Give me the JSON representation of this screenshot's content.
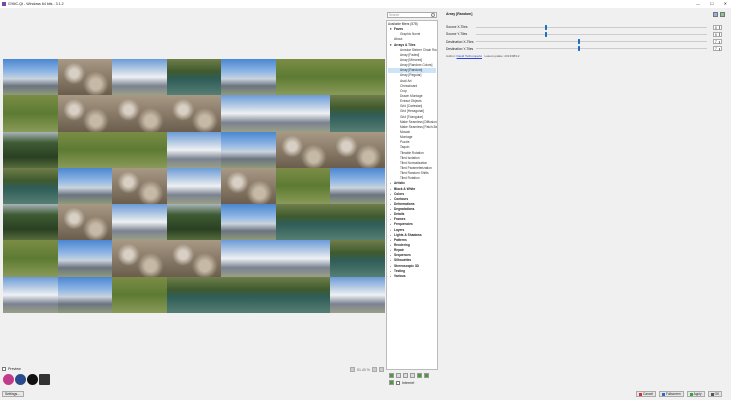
{
  "window": {
    "title": "G'MIC-Qt - Windows 64 bits - 3.1.2",
    "controls": [
      "—",
      "☐",
      "✕"
    ]
  },
  "preview": {
    "checkbox_label": "Preview",
    "checked": true,
    "zoom": "51.43 %"
  },
  "filters": {
    "search_placeholder": "Search",
    "header": "Available filters (578)",
    "items": [
      {
        "kind": "cat",
        "state": "exp",
        "label": "Faves"
      },
      {
        "kind": "it",
        "label": "Graphic Novel"
      },
      {
        "kind": "top",
        "label": "About"
      },
      {
        "kind": "cat",
        "state": "exp",
        "label": "Arrays & Tiles"
      },
      {
        "kind": "it",
        "label": "Annular Steiner Chain Round"
      },
      {
        "kind": "it",
        "label": "Array [Faded]"
      },
      {
        "kind": "it",
        "label": "Array [Mirrored]"
      },
      {
        "kind": "it",
        "label": "Array [Random Colors]"
      },
      {
        "kind": "it",
        "label": "Array [Random]",
        "selected": true
      },
      {
        "kind": "it",
        "label": "Array [Regular]"
      },
      {
        "kind": "it",
        "label": "Ascii Art"
      },
      {
        "kind": "it",
        "label": "Chessboard"
      },
      {
        "kind": "it",
        "label": "Crop"
      },
      {
        "kind": "it",
        "label": "Drawn Montage"
      },
      {
        "kind": "it",
        "label": "Extract Objects"
      },
      {
        "kind": "it",
        "label": "Grid [Cartesian]"
      },
      {
        "kind": "it",
        "label": "Grid [Hexagonal]"
      },
      {
        "kind": "it",
        "label": "Grid [Triangular]"
      },
      {
        "kind": "it",
        "label": "Make Seamless [Diffusion]"
      },
      {
        "kind": "it",
        "label": "Make Seamless [Patch-Based]"
      },
      {
        "kind": "it",
        "label": "Mosaic"
      },
      {
        "kind": "it",
        "label": "Montage"
      },
      {
        "kind": "it",
        "label": "Puzzle"
      },
      {
        "kind": "it",
        "label": "Taquin"
      },
      {
        "kind": "it",
        "label": "Tileable Rotation"
      },
      {
        "kind": "it",
        "label": "Tiled Isolation"
      },
      {
        "kind": "it",
        "label": "Tiled Normalization"
      },
      {
        "kind": "it",
        "label": "Tiled Parameterization"
      },
      {
        "kind": "it",
        "label": "Tiled Random Shifts"
      },
      {
        "kind": "it",
        "label": "Tiled Rotation"
      },
      {
        "kind": "cat",
        "state": "col",
        "label": "Artistic"
      },
      {
        "kind": "cat",
        "state": "col",
        "label": "Black & White"
      },
      {
        "kind": "cat",
        "state": "col",
        "label": "Colors"
      },
      {
        "kind": "cat",
        "state": "col",
        "label": "Contours"
      },
      {
        "kind": "cat",
        "state": "col",
        "label": "Deformations"
      },
      {
        "kind": "cat",
        "state": "col",
        "label": "Degradations"
      },
      {
        "kind": "cat",
        "state": "col",
        "label": "Details"
      },
      {
        "kind": "cat",
        "state": "col",
        "label": "Frames"
      },
      {
        "kind": "cat",
        "state": "col",
        "label": "Frequencies"
      },
      {
        "kind": "cat",
        "state": "col",
        "label": "Layers"
      },
      {
        "kind": "cat",
        "state": "col",
        "label": "Lights & Shadows"
      },
      {
        "kind": "cat",
        "state": "col",
        "label": "Patterns"
      },
      {
        "kind": "cat",
        "state": "col",
        "label": "Rendering"
      },
      {
        "kind": "cat",
        "state": "col",
        "label": "Repair"
      },
      {
        "kind": "cat",
        "state": "col",
        "label": "Sequences"
      },
      {
        "kind": "cat",
        "state": "col",
        "label": "Silhouettes"
      },
      {
        "kind": "cat",
        "state": "col",
        "label": "Stereoscopic 3D"
      },
      {
        "kind": "cat",
        "state": "col",
        "label": "Testing"
      },
      {
        "kind": "cat",
        "state": "col",
        "label": "Various"
      }
    ],
    "internet_label": "Internet",
    "internet_checked": true
  },
  "params": {
    "title": "Array [Random]",
    "rows": [
      {
        "label": "Source X-Tiles",
        "value": 5,
        "fraction": 0.3
      },
      {
        "label": "Source Y-Tiles",
        "value": 5,
        "fraction": 0.3
      },
      {
        "label": "Destination X-Tiles",
        "value": 7,
        "fraction": 0.44
      },
      {
        "label": "Destination Y-Tiles",
        "value": 7,
        "fraction": 0.44
      }
    ],
    "author_label": "Author:",
    "author": "David Tschumperlé",
    "update": "Latest update: 2013/08/12"
  },
  "buttons": {
    "settings": "Settings...",
    "cancel": "Cancel",
    "fullscreen": "Fullscreen",
    "apply": "Apply",
    "ok": "OK"
  },
  "colors": {
    "accent": "#1e6fc2",
    "selection": "#cce4f7"
  }
}
